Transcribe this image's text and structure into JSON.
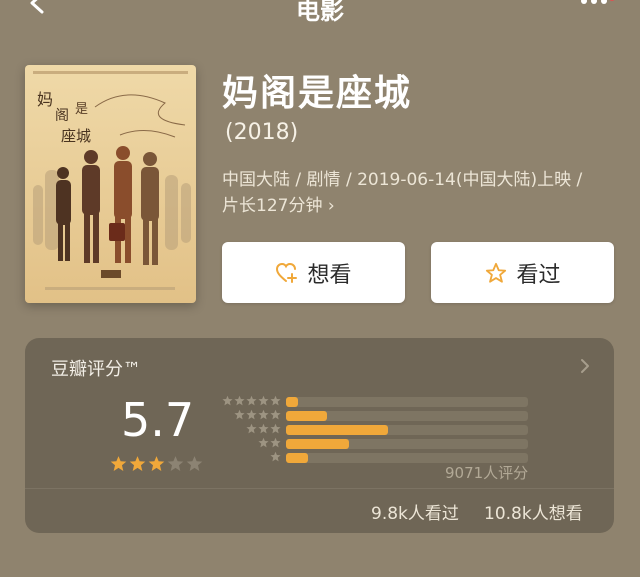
{
  "nav": {
    "title": "电影"
  },
  "movie": {
    "title": "妈阁是座城",
    "year": "(2018)",
    "meta": "中国大陆 / 剧情 / 2019-06-14(中国大陆)上映 / 片长127分钟",
    "meta_chevron": "›"
  },
  "actions": {
    "want_label": "想看",
    "seen_label": "看过"
  },
  "rating": {
    "label": "豆瓣评分™",
    "score": "5.7",
    "stars_filled": 3,
    "stars_total": 5,
    "distribution": [
      {
        "stars": 5,
        "percent": 5
      },
      {
        "stars": 4,
        "percent": 17
      },
      {
        "stars": 3,
        "percent": 42
      },
      {
        "stars": 2,
        "percent": 26
      },
      {
        "stars": 1,
        "percent": 9
      }
    ],
    "count": "9071人评分",
    "seen": "9.8k人看过",
    "want": "10.8k人想看"
  },
  "colors": {
    "background": "#8f836e",
    "card": "#6f6656",
    "accent": "#f0a83a"
  },
  "icons": [
    "back-icon",
    "more-icon",
    "heart-plus-icon",
    "star-icon",
    "chevron-right-icon"
  ]
}
